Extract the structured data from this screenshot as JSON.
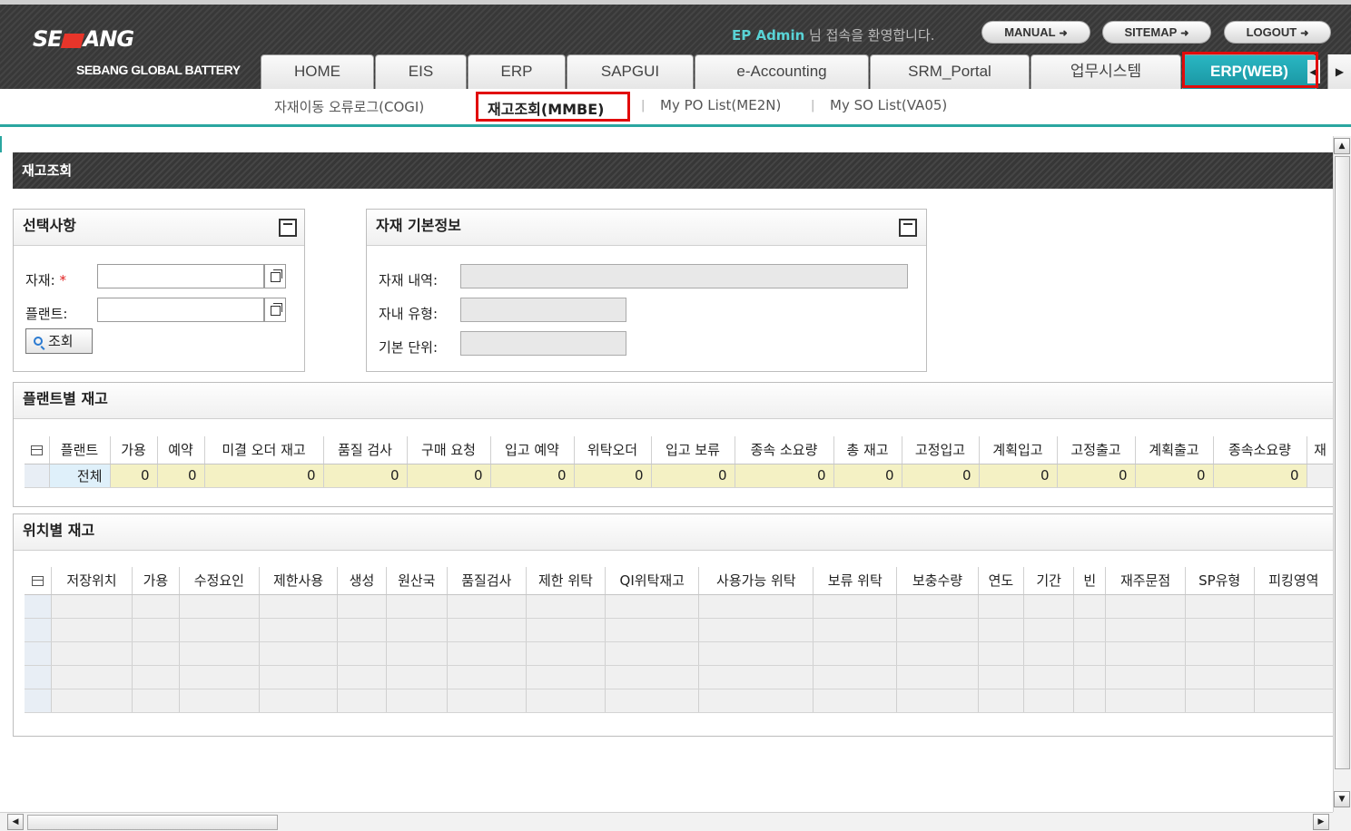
{
  "header": {
    "logo_text_1": "SE",
    "logo_text_2": "ANG",
    "logo_sub": "SEBANG GLOBAL BATTERY",
    "welcome_user": "EP Admin",
    "welcome_suffix": "님 접속을 환영합니다.",
    "buttons": {
      "manual": "MANUAL",
      "sitemap": "SITEMAP",
      "logout": "LOGOUT"
    },
    "tabs": [
      "HOME",
      "EIS",
      "ERP",
      "SAPGUI",
      "e-Accounting",
      "SRM_Portal",
      "업무시스템",
      "ERP(WEB)"
    ],
    "active_tab": "ERP(WEB)",
    "accent_color": "#1fa7b3"
  },
  "subnav": {
    "items": [
      "자재이동 오류로그(COGI)",
      "재고조회(MMBE)",
      "My PO List(ME2N)",
      "My SO List(VA05)"
    ],
    "active": "재고조회(MMBE)"
  },
  "page": {
    "title": "재고조회",
    "selection": {
      "title": "선택사항",
      "material_label": "자재:",
      "required_mark": "*",
      "plant_label": "플랜트:",
      "material_value": "",
      "plant_value": "",
      "search_button": "조회"
    },
    "material_info": {
      "title": "자재 기본정보",
      "desc_label": "자재 내역:",
      "type_label": "자내 유형:",
      "unit_label": "기본 단위:",
      "desc_value": "",
      "type_value": "",
      "unit_value": ""
    },
    "plant_stock": {
      "title": "플랜트별 재고",
      "columns": [
        "플랜트",
        "가용",
        "예약",
        "미결 오더 재고",
        "품질 검사",
        "구매 요청",
        "입고 예약",
        "위탁오더",
        "입고 보류",
        "종속 소요량",
        "총 재고",
        "고정입고",
        "계획입고",
        "고정출고",
        "계획출고",
        "종속소요량",
        "재"
      ],
      "rows": [
        [
          "전체",
          "0",
          "0",
          "0",
          "0",
          "0",
          "0",
          "0",
          "0",
          "0",
          "0",
          "0",
          "0",
          "0",
          "0",
          "0",
          ""
        ]
      ]
    },
    "location_stock": {
      "title": "위치별 재고",
      "columns": [
        "저장위치",
        "가용",
        "수정요인",
        "제한사용",
        "생성",
        "원산국",
        "품질검사",
        "제한 위탁",
        "QI위탁재고",
        "사용가능 위탁",
        "보류 위탁",
        "보충수량",
        "연도",
        "기간",
        "빈",
        "재주문점",
        "SP유형",
        "피킹영역"
      ],
      "empty_rows": 5
    }
  }
}
